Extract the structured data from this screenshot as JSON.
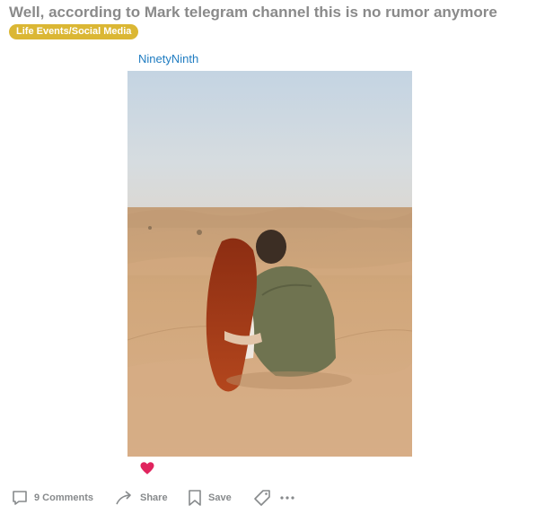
{
  "post": {
    "title": "Well, according to Mark telegram channel this is no rumor anymore",
    "flair": "Life Events/Social Media",
    "author": "NinetyNinth"
  },
  "reaction": {
    "icon": "heart-icon",
    "color": "#e0245e"
  },
  "actions": {
    "comments_label": "9 Comments",
    "share_label": "Share",
    "save_label": "Save"
  },
  "colors": {
    "title": "#8a8a8a",
    "flair_bg": "#dbb734",
    "author": "#1f7cc1",
    "action_text": "#878a8c"
  }
}
